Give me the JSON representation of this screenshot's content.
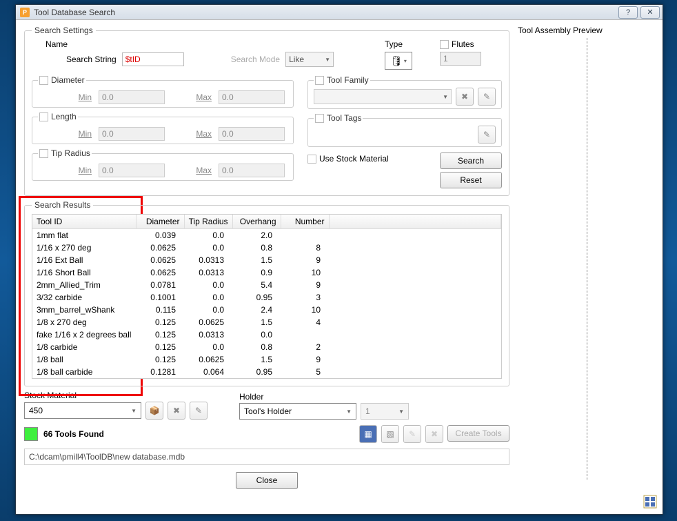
{
  "window": {
    "title": "Tool Database Search",
    "icon_letter": "P"
  },
  "search_settings": {
    "legend": "Search Settings",
    "name_label": "Name",
    "search_string_label": "Search String",
    "search_string_value": "$tID",
    "search_mode_label": "Search Mode",
    "search_mode_value": "Like",
    "type_label": "Type",
    "flutes_label": "Flutes",
    "flutes_value": "1",
    "diameter_label": "Diameter",
    "length_label": "Length",
    "tip_radius_label": "Tip Radius",
    "min_label": "Min",
    "max_label": "Max",
    "default_min": "0.0",
    "default_max": "0.0",
    "tool_family_label": "Tool Family",
    "tool_tags_label": "Tool Tags",
    "use_stock_label": "Use Stock Material",
    "search_btn": "Search",
    "reset_btn": "Reset"
  },
  "results": {
    "legend": "Search Results",
    "columns": [
      "Tool ID",
      "Diameter",
      "Tip Radius",
      "Overhang",
      "Number"
    ],
    "rows": [
      {
        "id": "1mm flat",
        "dia": "0.039",
        "tip": "0.0",
        "over": "2.0",
        "num": ""
      },
      {
        "id": "1/16 x 270 deg",
        "dia": "0.0625",
        "tip": "0.0",
        "over": "0.8",
        "num": "8"
      },
      {
        "id": "1/16 Ext Ball",
        "dia": "0.0625",
        "tip": "0.0313",
        "over": "1.5",
        "num": "9"
      },
      {
        "id": "1/16 Short Ball",
        "dia": "0.0625",
        "tip": "0.0313",
        "over": "0.9",
        "num": "10"
      },
      {
        "id": "2mm_Allied_Trim",
        "dia": "0.0781",
        "tip": "0.0",
        "over": "5.4",
        "num": "9"
      },
      {
        "id": "3/32 carbide",
        "dia": "0.1001",
        "tip": "0.0",
        "over": "0.95",
        "num": "3"
      },
      {
        "id": "3mm_barrel_wShank",
        "dia": "0.115",
        "tip": "0.0",
        "over": "2.4",
        "num": "10"
      },
      {
        "id": "1/8 x 270 deg",
        "dia": "0.125",
        "tip": "0.0625",
        "over": "1.5",
        "num": "4"
      },
      {
        "id": "fake 1/16 x 2 degrees ball",
        "dia": "0.125",
        "tip": "0.0313",
        "over": "0.0",
        "num": ""
      },
      {
        "id": "1/8 carbide",
        "dia": "0.125",
        "tip": "0.0",
        "over": "0.8",
        "num": "2"
      },
      {
        "id": "1/8 ball",
        "dia": "0.125",
        "tip": "0.0625",
        "over": "1.5",
        "num": "9"
      },
      {
        "id": "1/8 ball carbide",
        "dia": "0.1281",
        "tip": "0.064",
        "over": "0.95",
        "num": "5"
      }
    ]
  },
  "bottom": {
    "stock_label": "Stock Material",
    "stock_value": "450",
    "holder_label": "Holder",
    "holder_value": "Tool's Holder",
    "holder_num": "1",
    "tools_found": "66 Tools Found",
    "create_tools": "Create Tools",
    "path": "C:\\dcam\\pmill4\\ToolDB\\new database.mdb",
    "close": "Close"
  },
  "preview": {
    "label": "Tool Assembly Preview"
  }
}
